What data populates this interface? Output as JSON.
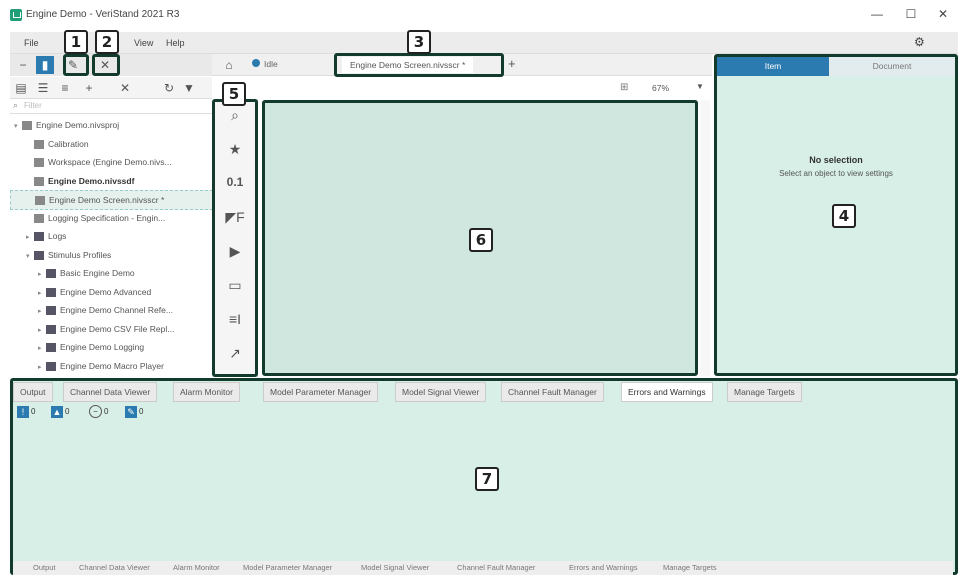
{
  "window": {
    "title": "Engine Demo - VeriStand 2021 R3",
    "minimize": "—",
    "maximize": "☐",
    "close": "✕"
  },
  "menu": [
    "File",
    "View",
    "Help"
  ],
  "tabs": {
    "home_icon": "home-icon",
    "idle_label": "Idle",
    "screen_tab": "Engine Demo Screen.nivsscr *",
    "add": "+",
    "zoom": "67%"
  },
  "search_placeholder": "Filter",
  "tree": [
    {
      "label": "Engine Demo.nivsproj",
      "indent": 0,
      "caret": "▾",
      "bold": false
    },
    {
      "label": "Calibration",
      "indent": 1,
      "caret": "",
      "bold": false
    },
    {
      "label": "Workspace (Engine Demo.nivs...",
      "indent": 1,
      "caret": "",
      "bold": false
    },
    {
      "label": "Engine Demo.nivssdf",
      "indent": 1,
      "caret": "",
      "bold": true
    },
    {
      "label": "Engine Demo Screen.nivsscr *",
      "indent": 1,
      "caret": "",
      "bold": false,
      "selected": true
    },
    {
      "label": "Logging Specification - Engin...",
      "indent": 1,
      "caret": "",
      "bold": false
    },
    {
      "label": "Logs",
      "indent": 1,
      "caret": "▸",
      "bold": false,
      "folder": true
    },
    {
      "label": "Stimulus Profiles",
      "indent": 1,
      "caret": "▾",
      "bold": false,
      "folder": true
    },
    {
      "label": "Basic Engine Demo",
      "indent": 2,
      "caret": "▸",
      "bold": false,
      "folder": true
    },
    {
      "label": "Engine Demo Advanced",
      "indent": 2,
      "caret": "▸",
      "bold": false,
      "folder": true
    },
    {
      "label": "Engine Demo Channel Refe...",
      "indent": 2,
      "caret": "▸",
      "bold": false,
      "folder": true
    },
    {
      "label": "Engine Demo CSV File Repl...",
      "indent": 2,
      "caret": "▸",
      "bold": false,
      "folder": true
    },
    {
      "label": "Engine Demo Logging",
      "indent": 2,
      "caret": "▸",
      "bold": false,
      "folder": true
    },
    {
      "label": "Engine Demo Macro Player",
      "indent": 2,
      "caret": "▸",
      "bold": false,
      "folder": true
    }
  ],
  "palette": [
    "⌕",
    "★",
    "0.1",
    "◤F",
    "▶",
    "▭",
    "≡I",
    "↗"
  ],
  "right_panel": {
    "tab_item": "Item",
    "tab_document": "Document",
    "no_selection": "No selection",
    "hint": "Select an object to view settings"
  },
  "bottom_tabs": [
    "Output",
    "Channel Data Viewer",
    "Alarm Monitor",
    "Model Parameter Manager",
    "Model Signal Viewer",
    "Channel Fault Manager",
    "Errors and Warnings",
    "Manage Targets"
  ],
  "bottom_active": "Errors and Warnings",
  "bottom_counts": [
    "0",
    "0",
    "0",
    "0"
  ],
  "bottom_footer": [
    "Output",
    "Channel Data Viewer",
    "Alarm Monitor",
    "Model Parameter Manager",
    "Model Signal Viewer",
    "Channel Fault Manager",
    "Errors and Warnings",
    "Manage Targets"
  ],
  "callouts": [
    "1",
    "2",
    "3",
    "4",
    "5",
    "6",
    "7"
  ],
  "colors": {
    "highlight": "#123b2c",
    "panel": "#d7efe7",
    "canvas": "#cfe7df",
    "accent": "#2b7bb0"
  }
}
